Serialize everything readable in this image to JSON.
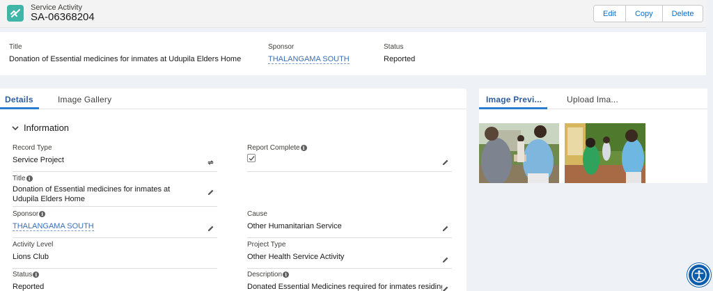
{
  "header": {
    "object_type": "Service Activity",
    "record_name": "SA-06368204",
    "buttons": {
      "edit": "Edit",
      "copy": "Copy",
      "delete": "Delete"
    }
  },
  "highlights": {
    "title_label": "Title",
    "title_value": "Donation of Essential medicines for inmates at Udupila Elders Home",
    "sponsor_label": "Sponsor",
    "sponsor_value": "THALANGAMA SOUTH",
    "status_label": "Status",
    "status_value": "Reported"
  },
  "tabs": {
    "details": "Details",
    "image_gallery": "Image Gallery"
  },
  "section": {
    "title": "Information"
  },
  "fields": {
    "record_type": {
      "label": "Record Type",
      "value": "Service Project"
    },
    "report_complete": {
      "label": "Report Complete",
      "checked": true
    },
    "title": {
      "label": "Title",
      "value": "Donation of Essential medicines for inmates at Udupila Elders Home"
    },
    "sponsor": {
      "label": "Sponsor",
      "value": "THALANGAMA SOUTH"
    },
    "cause": {
      "label": "Cause",
      "value": "Other Humanitarian Service"
    },
    "activity_level": {
      "label": "Activity Level",
      "value": "Lions Club"
    },
    "project_type": {
      "label": "Project Type",
      "value": "Other Health Service Activity"
    },
    "status": {
      "label": "Status",
      "value": "Reported"
    },
    "description": {
      "label": "Description",
      "value": "Donated Essential Medicines required for inmates residing"
    }
  },
  "right_panel": {
    "tabs": {
      "image_preview": "Image Previ...",
      "upload_image": "Upload Ima..."
    }
  },
  "colors": {
    "accent": "#2b7bd0",
    "link": "#3a6fb5",
    "object_icon": "#3fb6a8",
    "accessibility_button": "#0b5cab"
  },
  "icons": [
    "service-activity-icon",
    "chevron-down-icon",
    "info-icon",
    "pencil-edit-icon",
    "swap-icon",
    "accessibility-icon"
  ]
}
